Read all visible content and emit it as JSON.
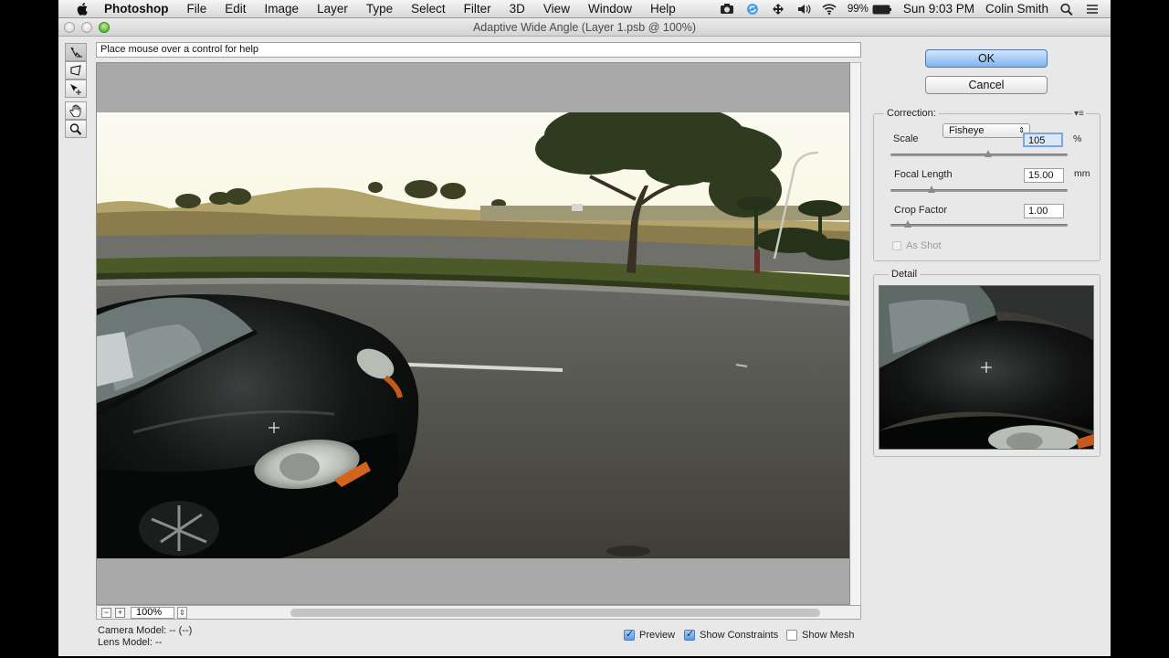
{
  "menubar": {
    "app_name": "Photoshop",
    "menus": [
      "File",
      "Edit",
      "Image",
      "Layer",
      "Type",
      "Select",
      "Filter",
      "3D",
      "View",
      "Window",
      "Help"
    ],
    "battery": "99%",
    "clock": "Sun 9:03 PM",
    "user": "Colin Smith"
  },
  "window": {
    "title": "Adaptive Wide Angle (Layer 1.psb @ 100%)"
  },
  "help_text": "Place mouse over a control for help",
  "buttons": {
    "ok": "OK",
    "cancel": "Cancel"
  },
  "correction": {
    "label": "Correction:",
    "selected": "Fisheye",
    "scale": {
      "label": "Scale",
      "value": "105",
      "unit": "%",
      "slider_fraction": 0.55
    },
    "focal_length": {
      "label": "Focal Length",
      "value": "15.00",
      "unit": "mm",
      "slider_fraction": 0.23
    },
    "crop_factor": {
      "label": "Crop Factor",
      "value": "1.00",
      "slider_fraction": 0.1
    },
    "as_shot": {
      "label": "As Shot",
      "checked": false
    }
  },
  "detail": {
    "label": "Detail"
  },
  "zoom": {
    "minus": "−",
    "plus": "+",
    "value": "100%"
  },
  "info": {
    "camera_model": "Camera Model: -- (--)",
    "lens_model": "Lens Model: --"
  },
  "options": {
    "preview": {
      "label": "Preview",
      "checked": true
    },
    "show_constraints": {
      "label": "Show Constraints",
      "checked": true
    },
    "show_mesh": {
      "label": "Show Mesh",
      "checked": false
    }
  }
}
